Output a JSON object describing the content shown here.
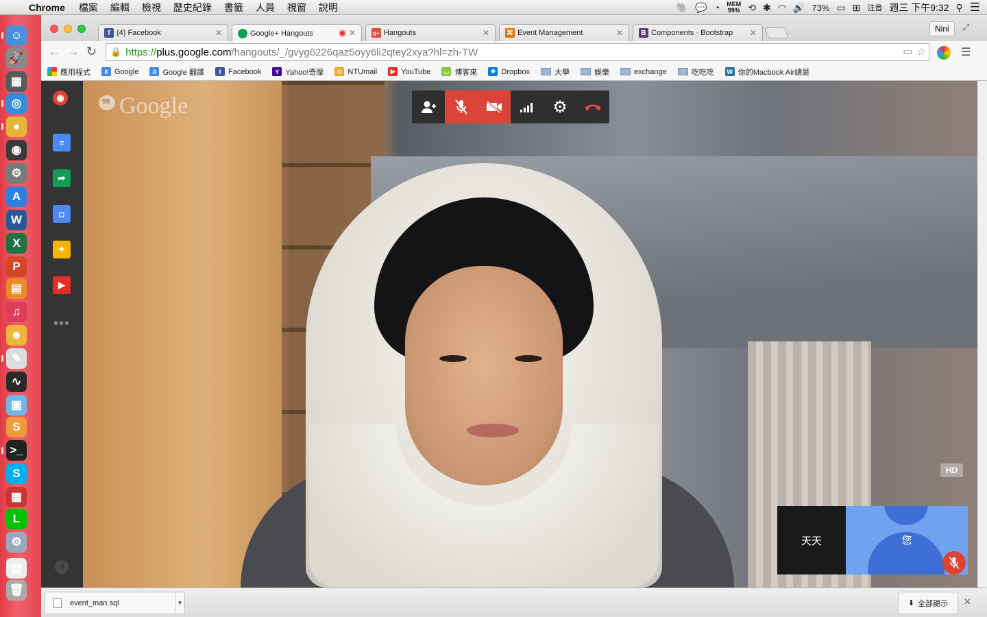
{
  "menubar": {
    "app_name": "Chrome",
    "menus": [
      "檔案",
      "編輯",
      "檢視",
      "歷史紀錄",
      "書籤",
      "人員",
      "視窗",
      "說明"
    ],
    "mem_label": "MEM",
    "mem_value": "99%",
    "battery": "73%",
    "input_method": "注音",
    "clock": "週三 下午9:32"
  },
  "dock": {
    "icons": [
      "finder-icon",
      "launchpad-icon",
      "mission-control-icon",
      "safari-icon",
      "chrome-icon",
      "photo-booth-icon",
      "system-preferences-icon",
      "app-store-icon",
      "word-icon",
      "excel-icon",
      "powerpoint-icon",
      "ibooks-icon",
      "itunes-icon",
      "qq-icon",
      "textedit-icon",
      "activity-monitor-icon",
      "preview-icon",
      "sublime-text-icon",
      "terminal-icon",
      "skype-icon",
      "app-icon",
      "line-icon",
      "utility-icon",
      "downloads-stack-icon",
      "trash-icon"
    ]
  },
  "tabs": [
    {
      "title": "(4) Facebook",
      "icon": "facebook-icon",
      "color": "#3b5998",
      "glyph": "f"
    },
    {
      "title": "Google+ Hangouts",
      "icon": "hangouts-icon",
      "color": "#0f9d58",
      "glyph": "",
      "active": true,
      "recording": true
    },
    {
      "title": "Hangouts",
      "icon": "google-plus-icon",
      "color": "#dd4b39",
      "glyph": "g+"
    },
    {
      "title": "Event Management",
      "icon": "event-icon",
      "color": "#e8710a",
      "glyph": "⌘"
    },
    {
      "title": "Components · Bootstrap",
      "icon": "bootstrap-icon",
      "color": "#563d7c",
      "glyph": "B"
    }
  ],
  "profile_name": "Nini",
  "url": {
    "scheme": "https://",
    "host": "plus.google.com",
    "path": "/hangouts/_/gvyg6226qaz5oyy6li2qtey2xya?hl=zh-TW"
  },
  "bookmarks": [
    {
      "label": "應用程式",
      "icon": "apps-icon",
      "type": "apps"
    },
    {
      "label": "Google",
      "icon": "google-icon",
      "type": "site",
      "color": "#4285f4",
      "glyph": "8"
    },
    {
      "label": "Google 翻譯",
      "icon": "translate-icon",
      "type": "site",
      "color": "#4285f4",
      "glyph": "A"
    },
    {
      "label": "Facebook",
      "icon": "facebook-icon",
      "type": "site",
      "color": "#3b5998",
      "glyph": "f"
    },
    {
      "label": "Yahoo!奇摩",
      "icon": "yahoo-icon",
      "type": "site",
      "color": "#400191",
      "glyph": "Y"
    },
    {
      "label": "NTUmail",
      "icon": "ntumail-icon",
      "type": "site",
      "color": "#f5a623",
      "glyph": "O"
    },
    {
      "label": "YouTube",
      "icon": "youtube-icon",
      "type": "site",
      "color": "#e52d27",
      "glyph": "▶"
    },
    {
      "label": "博客來",
      "icon": "books-icon",
      "type": "site",
      "color": "#8dc63f",
      "glyph": "◡"
    },
    {
      "label": "Dropbox",
      "icon": "dropbox-icon",
      "type": "site",
      "color": "#007ee5",
      "glyph": "❖"
    },
    {
      "label": "大學",
      "icon": "folder-icon",
      "type": "folder"
    },
    {
      "label": "娛樂",
      "icon": "folder-icon",
      "type": "folder"
    },
    {
      "label": "exchange",
      "icon": "folder-icon",
      "type": "folder"
    },
    {
      "label": "吃吃吃",
      "icon": "folder-icon",
      "type": "folder"
    },
    {
      "label": "你的Macbook Air總是",
      "icon": "wordpress-icon",
      "type": "site",
      "color": "#21759b",
      "glyph": "W"
    }
  ],
  "hangout": {
    "logo_text": "Google",
    "sidebar_apps": [
      {
        "icon": "hangouts-toolbox-icon",
        "color": "#db4437",
        "glyph": "◉"
      },
      {
        "icon": "chat-icon",
        "color": "#4a8af4",
        "glyph": "≡"
      },
      {
        "icon": "screenshare-icon",
        "color": "#0f9d58",
        "glyph": "➦"
      },
      {
        "icon": "capture-icon",
        "color": "#4a8af4",
        "glyph": "◘"
      },
      {
        "icon": "effects-icon",
        "color": "#f4b400",
        "glyph": "✦"
      },
      {
        "icon": "youtube-icon",
        "color": "#e52d27",
        "glyph": "▶"
      }
    ],
    "toolbar": [
      {
        "name": "invite-people-button",
        "icon": "add-person-icon",
        "glyph": "👤",
        "state": "normal"
      },
      {
        "name": "mute-mic-button",
        "icon": "mic-off-icon",
        "glyph": "🎙",
        "state": "active"
      },
      {
        "name": "turn-off-camera-button",
        "icon": "camera-off-icon",
        "glyph": "⛔",
        "state": "active"
      },
      {
        "name": "bandwidth-button",
        "icon": "signal-bars-icon",
        "glyph": "▂▄▆",
        "state": "normal"
      },
      {
        "name": "settings-button",
        "icon": "gear-icon",
        "glyph": "⚙",
        "state": "normal"
      },
      {
        "name": "hang-up-button",
        "icon": "hang-up-icon",
        "glyph": "☎",
        "state": "hangup"
      }
    ],
    "hd_label": "HD",
    "participants": [
      {
        "name": "天天",
        "bg": "#1a1a1a"
      },
      {
        "name": "您",
        "bg": "#6fa3ef",
        "self": true,
        "muted": true
      }
    ]
  },
  "download": {
    "filename": "event_man.sql",
    "show_all": "全部顯示"
  }
}
